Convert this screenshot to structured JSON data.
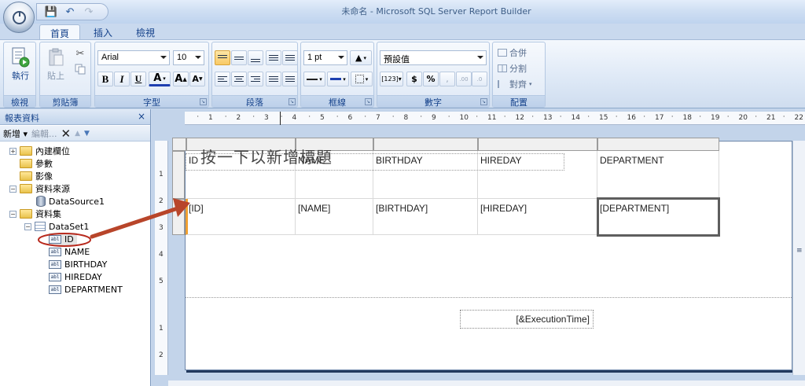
{
  "window": {
    "title": "未命名 - Microsoft SQL Server Report Builder"
  },
  "quick_access": {
    "icons": [
      "save-icon",
      "undo-icon",
      "redo-icon"
    ]
  },
  "tabs": [
    {
      "label": "首頁",
      "active": true
    },
    {
      "label": "插入"
    },
    {
      "label": "檢視"
    }
  ],
  "ribbon": {
    "view": {
      "run_label": "執行",
      "group_label": "檢視"
    },
    "clipboard": {
      "paste_label": "貼上",
      "group_label": "剪貼簿"
    },
    "font": {
      "family": "Arial",
      "size": "10",
      "bold": "B",
      "italic": "I",
      "underline": "U",
      "color_glyph": "A",
      "grow": "A",
      "shrink": "A",
      "group_label": "字型"
    },
    "paragraph": {
      "group_label": "段落"
    },
    "border": {
      "width": "1 pt",
      "group_label": "框線"
    },
    "number": {
      "format": "預設值",
      "currency": "$",
      "percent": "%",
      "group_label": "數字"
    },
    "arrange": {
      "merge_label": "合併",
      "split_label": "分割",
      "align_label": "對齊",
      "group_label": "配置"
    }
  },
  "report_data": {
    "title": "報表資料",
    "close": "×",
    "toolbar": {
      "new_label": "新增",
      "edit_label": "編輯..."
    },
    "tree": [
      {
        "label": "內建欄位",
        "type": "folder",
        "expander": "+"
      },
      {
        "label": "參數",
        "type": "folder"
      },
      {
        "label": "影像",
        "type": "folder"
      },
      {
        "label": "資料來源",
        "type": "folder",
        "expander": "−"
      },
      {
        "label": "DataSource1",
        "type": "datasource"
      },
      {
        "label": "資料集",
        "type": "folder",
        "expander": "−"
      },
      {
        "label": "DataSet1",
        "type": "dataset",
        "expander": "−"
      },
      {
        "label": "ID",
        "type": "field",
        "selected": true
      },
      {
        "label": "NAME",
        "type": "field"
      },
      {
        "label": "BIRTHDAY",
        "type": "field"
      },
      {
        "label": "HIREDAY",
        "type": "field"
      },
      {
        "label": "DEPARTMENT",
        "type": "field"
      }
    ],
    "field_icon_text": "abl"
  },
  "ruler": {
    "top": [
      "1",
      "2",
      "3",
      "4",
      "5",
      "6",
      "7",
      "8",
      "9",
      "10",
      "11",
      "12",
      "13",
      "14",
      "15",
      "16",
      "17",
      "18",
      "19",
      "20",
      "21",
      "22"
    ],
    "left": [
      "1",
      "2",
      "3",
      "4",
      "5",
      "1",
      "2"
    ]
  },
  "table": {
    "headers": [
      "ID",
      "NAME",
      "BIRTHDAY",
      "HIREDAY",
      "DEPARTMENT"
    ],
    "details": [
      "[ID]",
      "[NAME]",
      "[BIRTHDAY]",
      "[HIREDAY]",
      "[DEPARTMENT]"
    ]
  },
  "annotation": "按一下以新增標題",
  "footer": {
    "execution_time": "[&ExecutionTime]"
  },
  "colors": {
    "accent": "#c0392b",
    "selection_orange": "#f0a030"
  }
}
